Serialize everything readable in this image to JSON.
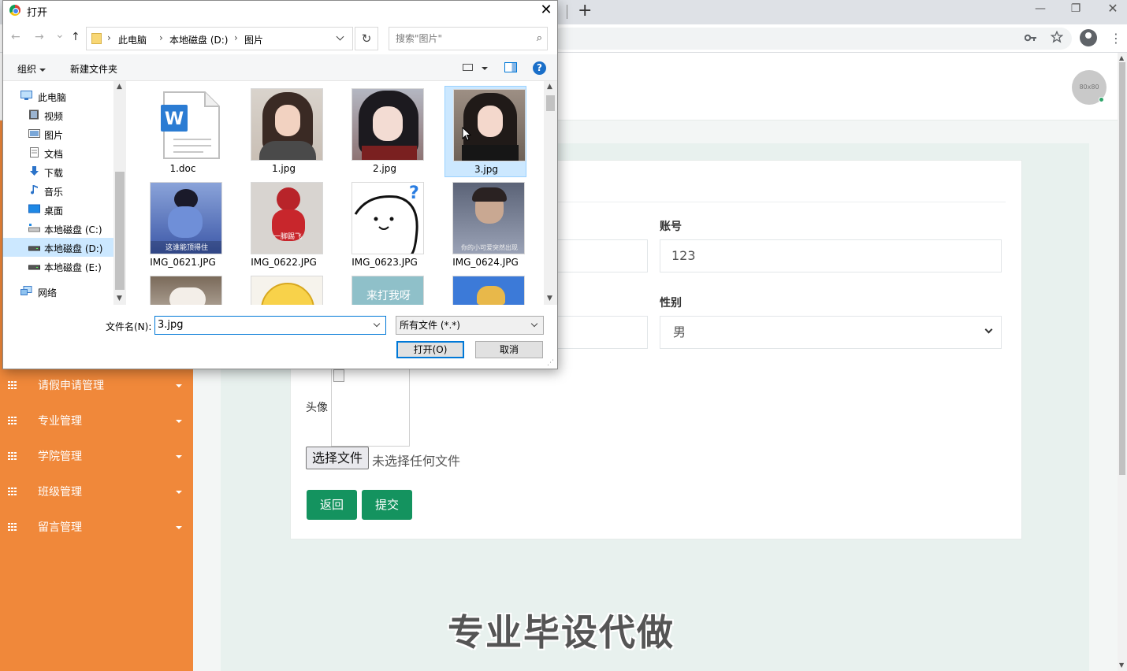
{
  "browser": {
    "new_tab_symbol": "+",
    "minimize": "—",
    "restore": "❐",
    "close": "✕",
    "key_icon": "key-icon",
    "star_icon": "star-icon",
    "menu_dots": "⋮"
  },
  "page": {
    "avatar_text": "80x80",
    "sidebar": {
      "items": [
        {
          "label": "请假申请管理"
        },
        {
          "label": "专业管理"
        },
        {
          "label": "学院管理"
        },
        {
          "label": "班级管理"
        },
        {
          "label": "留言管理"
        }
      ]
    },
    "form": {
      "account_label": "账号",
      "account_value": "123",
      "gender_label": "性别",
      "gender_value": "男",
      "avatar_label": "头像",
      "file_button": "选择文件",
      "file_status": "未选择任何文件",
      "back_button": "返回",
      "submit_button": "提交"
    },
    "watermark": "专业毕设代做",
    "colors": {
      "sidebar": "#f0883a",
      "button_green": "#14935f",
      "content_bg": "#e8f1ee"
    }
  },
  "dialog": {
    "title": "打开",
    "close": "✕",
    "nav": {
      "back": "←",
      "forward": "→",
      "recent": "⌄",
      "up": "↑",
      "breadcrumb": [
        "此电脑",
        "本地磁盘 (D:)",
        "图片"
      ],
      "separator": "›",
      "refresh": "↻",
      "search_placeholder": "搜索\"图片\"",
      "search_icon": "⌕"
    },
    "commands": {
      "organize": "组织",
      "new_folder": "新建文件夹",
      "help": "?"
    },
    "tree": [
      {
        "label": "此电脑",
        "icon": "computer-icon"
      },
      {
        "label": "视频",
        "icon": "video-icon"
      },
      {
        "label": "图片",
        "icon": "pictures-icon"
      },
      {
        "label": "文档",
        "icon": "documents-icon"
      },
      {
        "label": "下载",
        "icon": "download-icon"
      },
      {
        "label": "音乐",
        "icon": "music-icon"
      },
      {
        "label": "桌面",
        "icon": "desktop-icon"
      },
      {
        "label": "本地磁盘 (C:)",
        "icon": "drive-icon"
      },
      {
        "label": "本地磁盘 (D:)",
        "icon": "drive-icon",
        "selected": true
      },
      {
        "label": "本地磁盘 (E:)",
        "icon": "drive-icon"
      },
      {
        "label": "网络",
        "icon": "network-icon"
      }
    ],
    "files": [
      {
        "name": "1.doc",
        "kind": "word-doc"
      },
      {
        "name": "1.jpg",
        "kind": "photo"
      },
      {
        "name": "2.jpg",
        "kind": "photo"
      },
      {
        "name": "3.jpg",
        "kind": "photo",
        "selected": true
      },
      {
        "name": "IMG_0621.JPG",
        "kind": "photo",
        "caption": "这谁能顶得住"
      },
      {
        "name": "IMG_0622.JPG",
        "kind": "photo",
        "caption": "一脚踢飞"
      },
      {
        "name": "IMG_0623.JPG",
        "kind": "sketch"
      },
      {
        "name": "IMG_0624.JPG",
        "kind": "photo",
        "caption": "你的小可爱突然出现"
      },
      {
        "name": "",
        "kind": "photo"
      },
      {
        "name": "",
        "kind": "emoji"
      },
      {
        "name": "",
        "kind": "photo",
        "caption": "来打我呀"
      },
      {
        "name": "",
        "kind": "photo"
      }
    ],
    "filename_label": "文件名(N):",
    "filename_value": "3.jpg",
    "filetype_value": "所有文件 (*.*)",
    "open_button": "打开(O)",
    "cancel_button": "取消"
  }
}
